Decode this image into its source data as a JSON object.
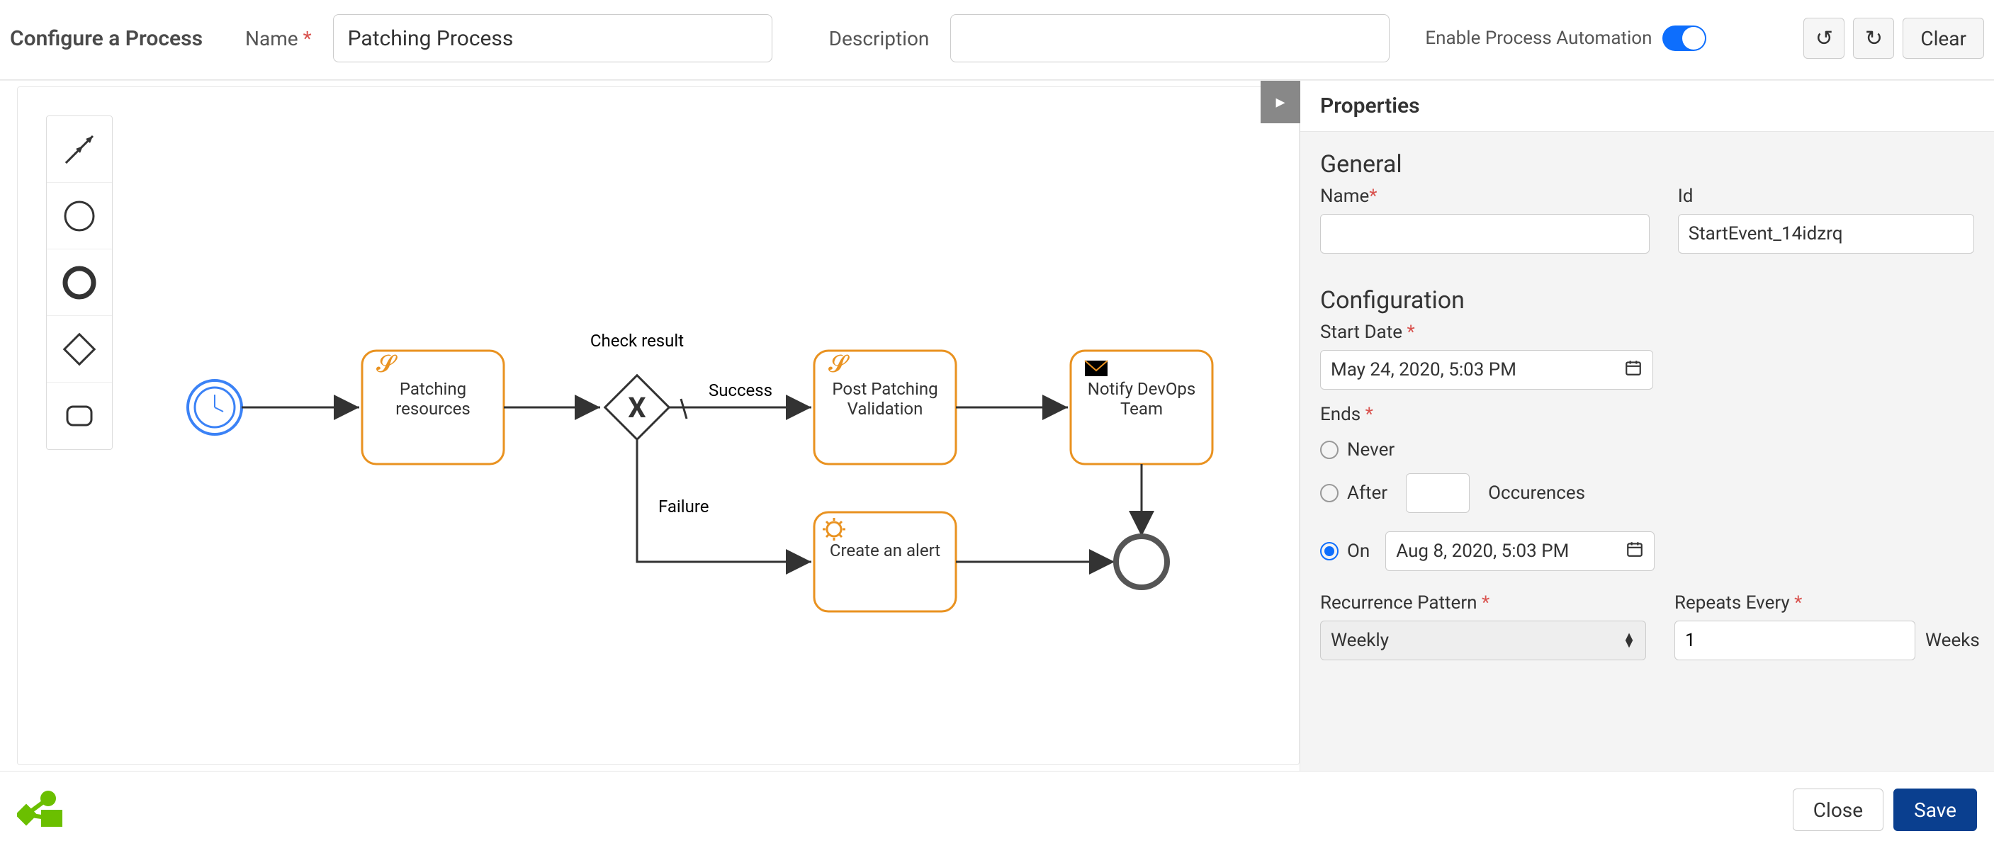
{
  "topbar": {
    "title": "Configure a Process",
    "name_label": "Name",
    "name_value": "Patching Process",
    "description_label": "Description",
    "description_value": "",
    "automation_label": "Enable Process Automation",
    "automation_enabled": true,
    "clear_label": "Clear"
  },
  "diagram": {
    "start_event": {
      "type": "timer-start"
    },
    "tasks": {
      "patching": {
        "label": "Patching resources",
        "type": "script"
      },
      "validation": {
        "label": "Post Patching Validation",
        "type": "script"
      },
      "notify": {
        "label": "Notify DevOps Team",
        "type": "message"
      },
      "alert": {
        "label": "Create an alert",
        "type": "service"
      }
    },
    "gateway": {
      "label": "Check result",
      "type": "exclusive"
    },
    "flows": {
      "success": "Success",
      "failure": "Failure"
    },
    "end_event": {
      "type": "end"
    }
  },
  "palette": {
    "tools": [
      "connect-tool",
      "start-event",
      "intermediate-event",
      "gateway",
      "task"
    ]
  },
  "properties": {
    "panel_title": "Properties",
    "general_title": "General",
    "name_label": "Name",
    "name_value": "",
    "id_label": "Id",
    "id_value": "StartEvent_14idzrq",
    "config_title": "Configuration",
    "start_date_label": "Start Date",
    "start_date_value": "May 24, 2020, 5:03 PM",
    "ends_label": "Ends",
    "ends_never": "Never",
    "ends_after": "After",
    "ends_occurrences_label": "Occurences",
    "ends_on": "On",
    "ends_on_value": "Aug 8, 2020, 5:03 PM",
    "ends_selected": "on",
    "recurrence_label": "Recurrence Pattern",
    "recurrence_value": "Weekly",
    "repeats_label": "Repeats Every",
    "repeats_value": "1",
    "repeats_unit": "Weeks"
  },
  "footer": {
    "close_label": "Close",
    "save_label": "Save"
  }
}
